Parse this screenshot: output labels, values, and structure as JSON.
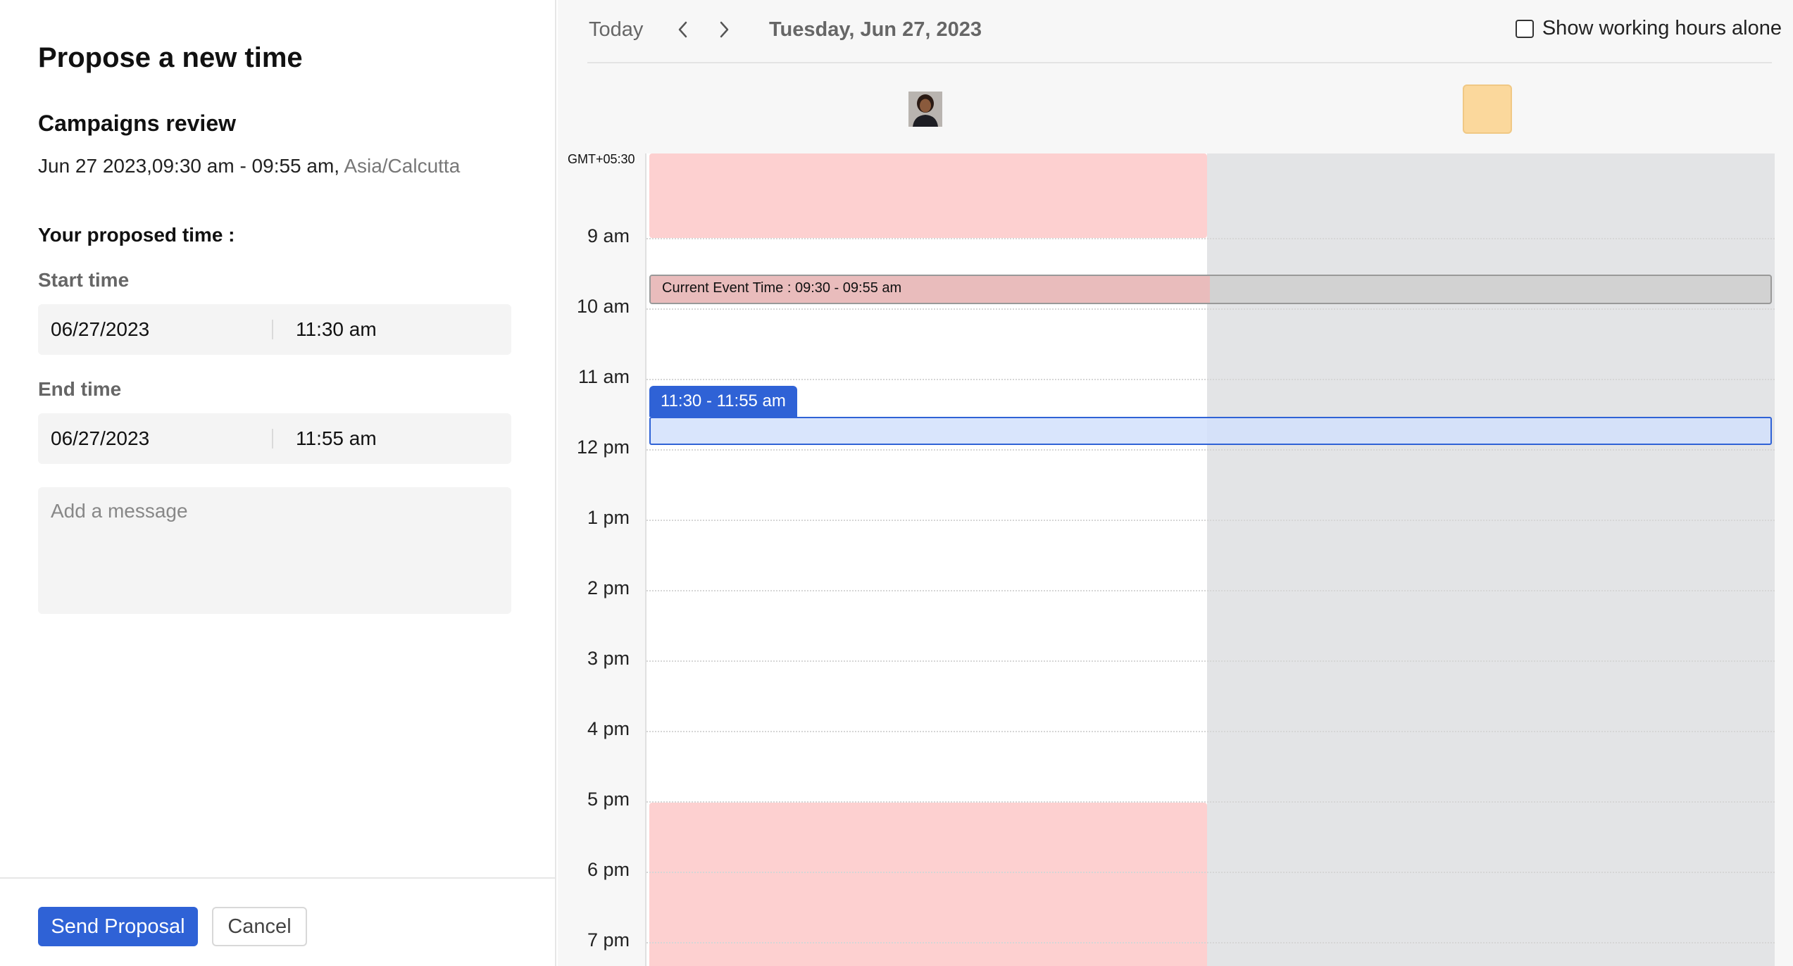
{
  "dialog": {
    "title": "Propose a new time",
    "event_name": "Campaigns review",
    "event_time": "Jun 27 2023,09:30 am - 09:55 am,",
    "timezone": "Asia/Calcutta",
    "proposed_label": "Your proposed time :",
    "start": {
      "label": "Start time",
      "date": "06/27/2023",
      "time": "11:30 am"
    },
    "end": {
      "label": "End time",
      "date": "06/27/2023",
      "time": "11:55 am"
    },
    "message": {
      "placeholder": "Add a message"
    },
    "send_label": "Send Proposal",
    "cancel_label": "Cancel"
  },
  "calendar": {
    "today_label": "Today",
    "date_label": "Tuesday, Jun 27, 2023",
    "working_hours_label": "Show working hours alone",
    "working_hours_checked": false,
    "gmt_label": "GMT+05:30",
    "hours": [
      "9 am",
      "10 am",
      "11 am",
      "12 pm",
      "1 pm",
      "2 pm",
      "3 pm",
      "4 pm",
      "5 pm",
      "6 pm",
      "7 pm"
    ],
    "current_event_label": "Current Event Time : 09:30 - 09:55 am",
    "proposed_range_label": "11:30 - 11:55 am",
    "attendees": [
      "avatar-photo",
      "avatar-placeholder"
    ]
  },
  "colors": {
    "primary": "#2f62d6",
    "busy": "#fdd0d0",
    "unavailable": "#e3e4e6",
    "placeholder_avatar": "#fbd89c"
  }
}
